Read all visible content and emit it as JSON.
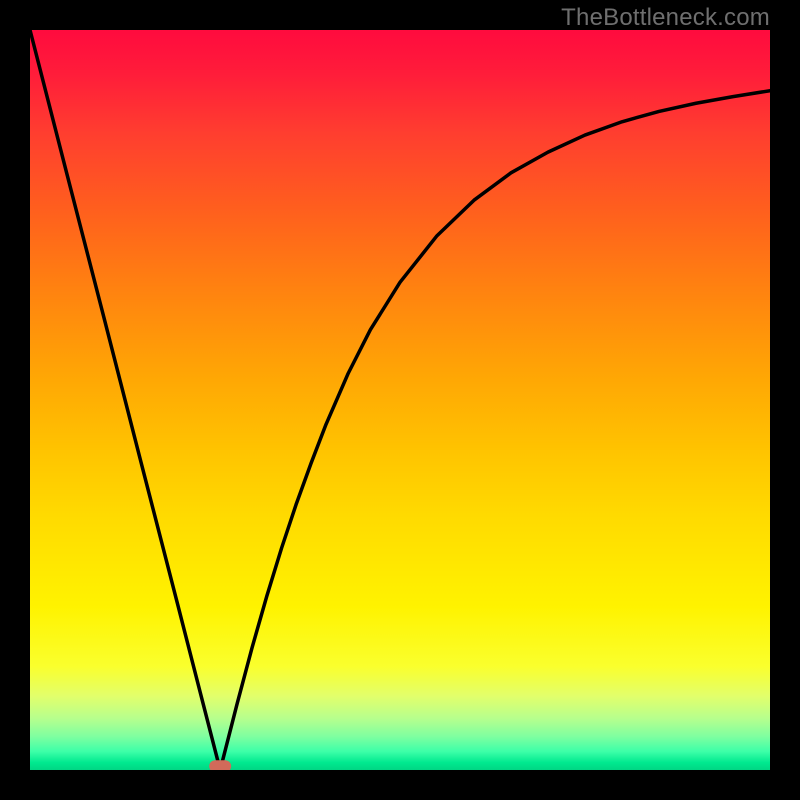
{
  "watermark": "TheBottleneck.com",
  "chart_data": {
    "type": "line",
    "title": "",
    "xlabel": "",
    "ylabel": "",
    "xlim": [
      0,
      100
    ],
    "ylim": [
      0,
      100
    ],
    "grid": false,
    "legend": false,
    "marker": {
      "x": 25.7,
      "y": 0.5,
      "color": "#d16a5a",
      "shape": "pill"
    },
    "series": [
      {
        "name": "curve",
        "color": "#000000",
        "x": [
          0,
          5,
          10,
          15,
          20,
          23,
          25.7,
          28,
          30,
          32,
          34,
          36,
          38,
          40,
          43,
          46,
          50,
          55,
          60,
          65,
          70,
          75,
          80,
          85,
          90,
          95,
          100
        ],
        "y": [
          100.0,
          80.5,
          61.1,
          41.6,
          22.2,
          10.5,
          0.0,
          9.0,
          16.5,
          23.5,
          30.0,
          36.0,
          41.5,
          46.7,
          53.6,
          59.5,
          65.9,
          72.2,
          77.0,
          80.7,
          83.5,
          85.8,
          87.6,
          89.0,
          90.1,
          91.0,
          91.8
        ]
      }
    ]
  }
}
